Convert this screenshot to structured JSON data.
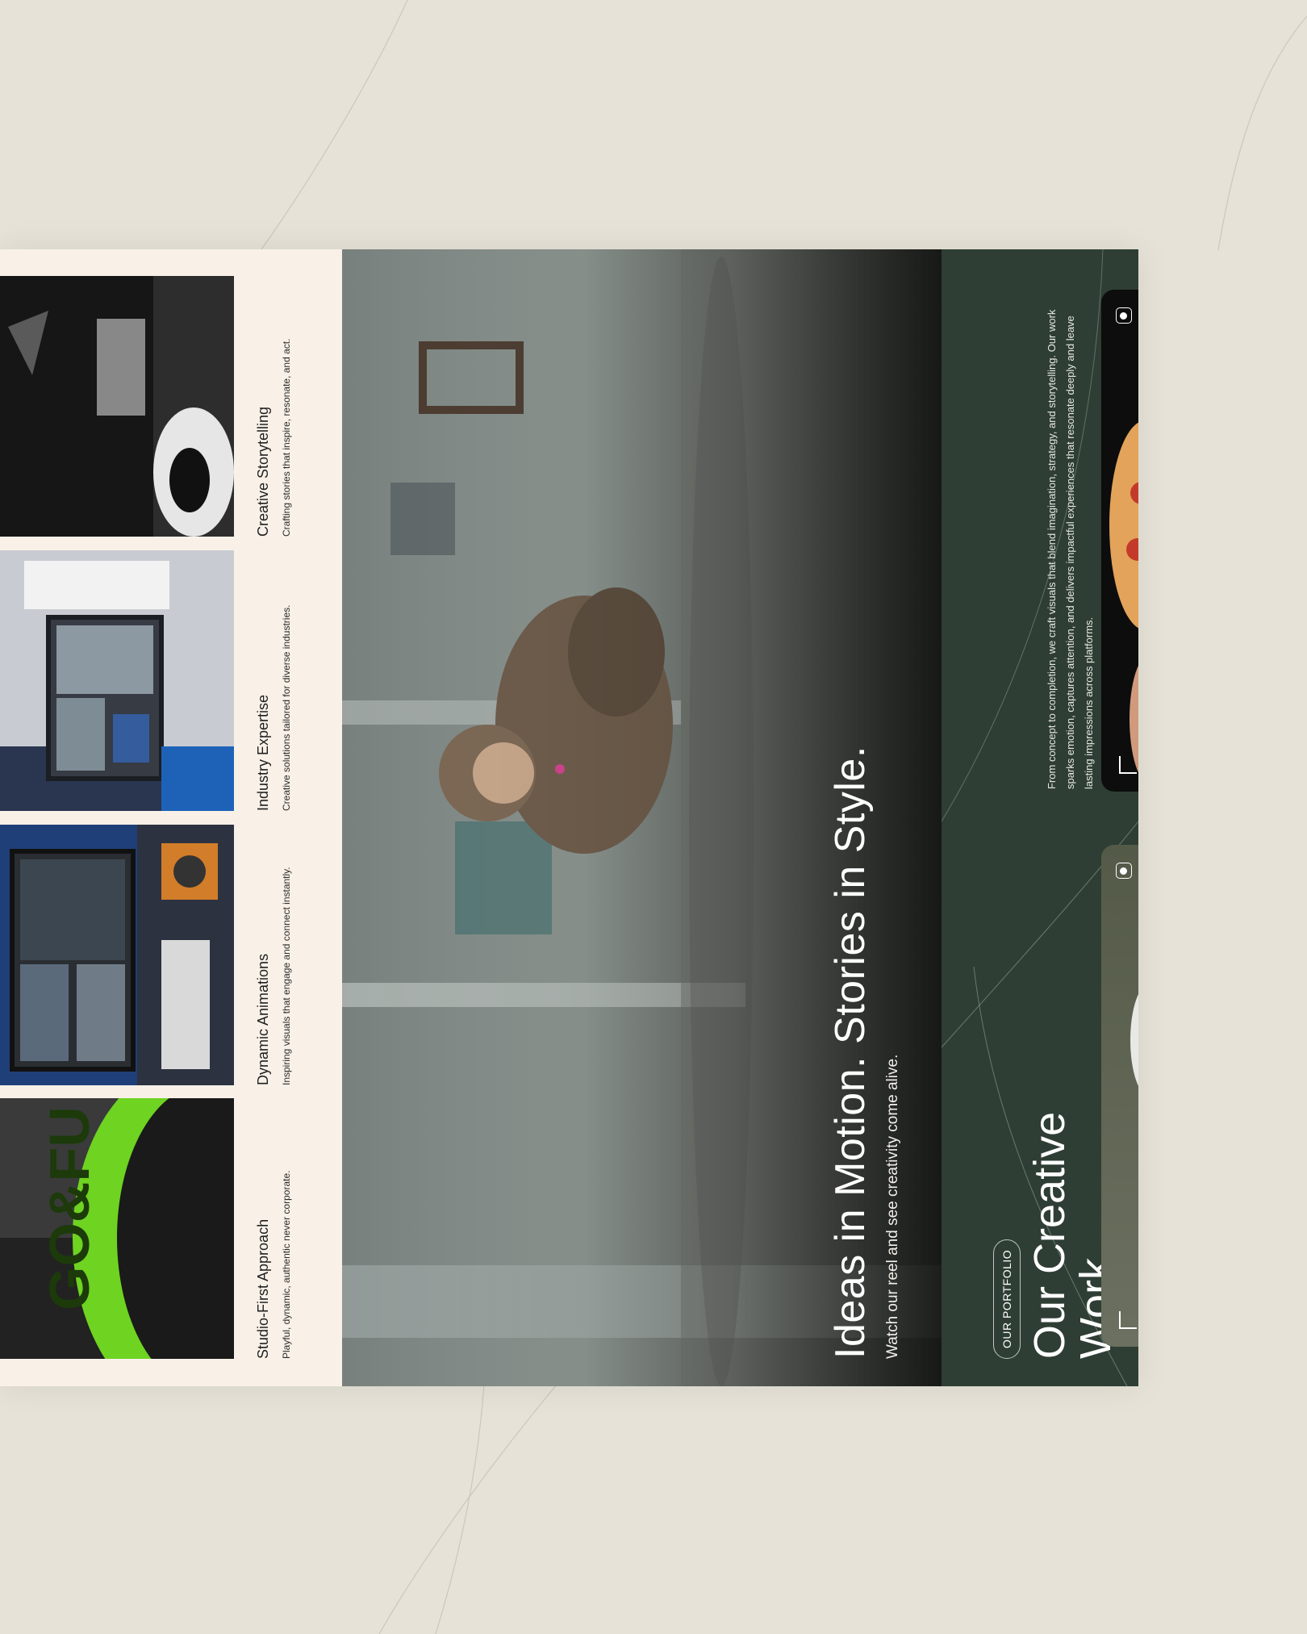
{
  "features": [
    {
      "title": "Studio-First Approach",
      "description": "Playful, dynamic, authentic never corporate.",
      "photo_icon": "helmet-photo"
    },
    {
      "title": "Dynamic Animations",
      "description": "Inspiring visuals that engage and connect instantly.",
      "photo_icon": "editing-desk-photo"
    },
    {
      "title": "Industry Expertise",
      "description": "Creative solutions tailored for diverse industries.",
      "photo_icon": "laptop-photo"
    },
    {
      "title": "Creative Storytelling",
      "description": "Crafting stories that inspire, resonate, and act.",
      "photo_icon": "fabric-photo"
    }
  ],
  "hero": {
    "headline": "Ideas in Motion. Stories in Style.",
    "subtitle": "Watch our reel and see creativity come alive."
  },
  "portfolio": {
    "badge": "OUR PORTFOLIO",
    "heading": "Our Creative Work",
    "description": "From concept to completion, we craft visuals that blend imagination, strategy, and storytelling. Our work sparks emotion, captures attention, and delivers impactful experiences that resonate deeply and leave lasting impressions across platforms.",
    "cards": [
      {
        "icon": "camera-icon",
        "photo": "sneakers-photo"
      },
      {
        "icon": "camera-icon",
        "photo": "pizza-photo"
      }
    ]
  },
  "colors": {
    "page_background": "#e6e2d7",
    "features_background": "#f9f1e8",
    "portfolio_background": "#2f3e34",
    "accent_green": "#7ed321"
  }
}
